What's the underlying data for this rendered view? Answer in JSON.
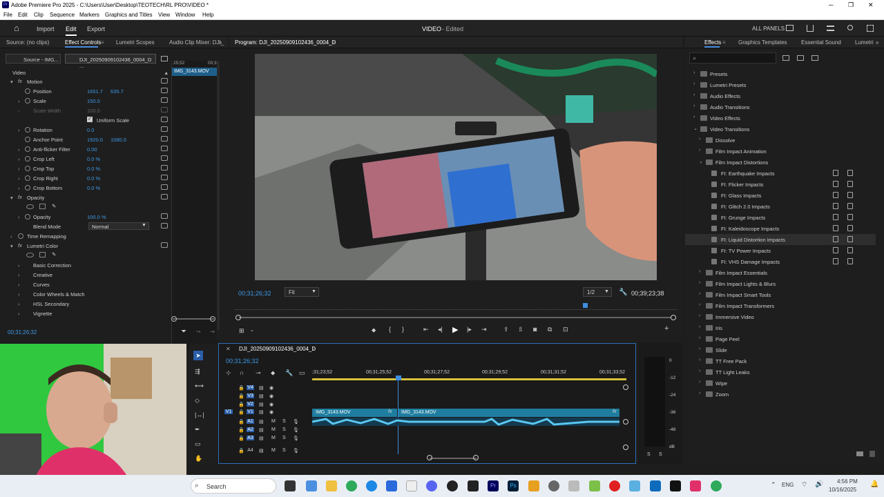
{
  "window": {
    "title": "Adobe Premiere Pro 2025 - C:\\Users\\User\\Desktop\\TEOTECH\\RL PRO\\VIDEO *",
    "minimize": "─",
    "maximize": "❐",
    "close": "✕"
  },
  "menu": [
    "File",
    "Edit",
    "Clip",
    "Sequence",
    "Markers",
    "Graphics and Titles",
    "View",
    "Window",
    "Help"
  ],
  "topbar": {
    "home": "⌂",
    "import": "Import",
    "edit": "Edit",
    "export": "Export",
    "project_title": "VIDEO",
    "project_status": "- Edited",
    "all_panels": "ALL PANELS"
  },
  "left_tabs": {
    "source": "Source: (no clips)",
    "effect_controls": "Effect Controls",
    "lumetri_scopes": "Lumetri Scopes",
    "audio_mixer": "Audio Clip Mixer: DJI_"
  },
  "ec": {
    "source_dd": "Source - IMG...",
    "clip_dd": "DJI_20250909102436_0004_D ...",
    "mini_time": "25;52",
    "mini_time2": "00;3",
    "clip_label": "IMG_3143.MOV",
    "section_video": "Video",
    "motion": "Motion",
    "position": "Position",
    "position_x": "1651.7",
    "position_y": "635.7",
    "scale": "Scale",
    "scale_v": "150.0",
    "scale_width": "Scale Width",
    "scale_width_v": "100.0",
    "uniform_scale": "Uniform Scale",
    "rotation": "Rotation",
    "rotation_v": "0.0",
    "anchor": "Anchor Point",
    "anchor_x": "1920.0",
    "anchor_y": "1080.0",
    "antiflicker": "Anti-flicker Filter",
    "antiflicker_v": "0.00",
    "crop_left": "Crop Left",
    "crop_left_v": "0.0 %",
    "crop_top": "Crop Top",
    "crop_top_v": "0.0 %",
    "crop_right": "Crop Right",
    "crop_right_v": "0.0 %",
    "crop_bottom": "Crop Bottom",
    "crop_bottom_v": "0.0 %",
    "opacity_group": "Opacity",
    "opacity": "Opacity",
    "opacity_v": "100.0 %",
    "blend": "Blend Mode",
    "blend_v": "Normal",
    "time_remap": "Time Remapping",
    "lumetri": "Lumetri Color",
    "basic": "Basic Correction",
    "creative": "Creative",
    "curves": "Curves",
    "wheels": "Color Wheels & Match",
    "hsl": "HSL Secondary",
    "vignette": "Vignette",
    "timecode": "00;31;26;32"
  },
  "program": {
    "tab": "Program: DJI_20250909102436_0004_D",
    "timecode": "00;31;26;32",
    "fit": "Fit",
    "resolution": "1/2",
    "duration": "00;39;23;38"
  },
  "effects": {
    "tab": "Effects",
    "tab_graphics": "Graphics Templates",
    "tab_sound": "Essential Sound",
    "tab_lumetri": "Lumetri",
    "tree": [
      {
        "d": 0,
        "label": "Presets",
        "open": false
      },
      {
        "d": 0,
        "label": "Lumetri Presets",
        "open": false
      },
      {
        "d": 0,
        "label": "Audio Effects",
        "open": false
      },
      {
        "d": 0,
        "label": "Audio Transitions",
        "open": false
      },
      {
        "d": 0,
        "label": "Video Effects",
        "open": false
      },
      {
        "d": 0,
        "label": "Video Transitions",
        "open": true
      },
      {
        "d": 1,
        "label": "Dissolve",
        "open": false
      },
      {
        "d": 1,
        "label": "Film Impact Animation",
        "open": false
      },
      {
        "d": 1,
        "label": "Film Impact Distortions",
        "open": true
      },
      {
        "d": 2,
        "label": "FI: Earthquake Impacts",
        "item": true
      },
      {
        "d": 2,
        "label": "FI: Flicker Impacts",
        "item": true
      },
      {
        "d": 2,
        "label": "FI: Glass Impacts",
        "item": true
      },
      {
        "d": 2,
        "label": "FI: Glitch 2.0 Impacts",
        "item": true
      },
      {
        "d": 2,
        "label": "FI: Grunge Impacts",
        "item": true
      },
      {
        "d": 2,
        "label": "FI: Kaleidoscope Impacts",
        "item": true
      },
      {
        "d": 2,
        "label": "FI: Liquid Distortion Impacts",
        "item": true,
        "sel": true
      },
      {
        "d": 2,
        "label": "FI: TV Power Impacts",
        "item": true
      },
      {
        "d": 2,
        "label": "FI: VHS Damage Impacts",
        "item": true
      },
      {
        "d": 1,
        "label": "Film Impact Essentials",
        "open": false
      },
      {
        "d": 1,
        "label": "Film Impact Lights & Blurs",
        "open": false
      },
      {
        "d": 1,
        "label": "Film Impact Smart Tools",
        "open": false
      },
      {
        "d": 1,
        "label": "Film Impact Transformers",
        "open": false
      },
      {
        "d": 1,
        "label": "Immersive Video",
        "open": false
      },
      {
        "d": 1,
        "label": "Iris",
        "open": false
      },
      {
        "d": 1,
        "label": "Page Peel",
        "open": false
      },
      {
        "d": 1,
        "label": "Slide",
        "open": false
      },
      {
        "d": 1,
        "label": "TT Free Pack",
        "open": false
      },
      {
        "d": 1,
        "label": "TT Light Leaks",
        "open": false
      },
      {
        "d": 1,
        "label": "Wipe",
        "open": false
      },
      {
        "d": 1,
        "label": "Zoom",
        "open": false
      }
    ]
  },
  "timeline": {
    "tab": "DJI_20250909102436_0004_D",
    "timecode": "00;31;26;32",
    "ruler": [
      ";31;23;52",
      "00;31;25;52",
      "00;31;27;52",
      "00;31;29;52",
      "00;31;31;52",
      "00;31;33;52"
    ],
    "tracks_v": [
      "V4",
      "V3",
      "V2",
      "V1"
    ],
    "tracks_a": [
      "A1",
      "A2",
      "A3",
      "A4"
    ],
    "clip1": "IMG_3143.MOV",
    "clip2": "IMG_3143.MOV",
    "meter": [
      "0",
      "-12",
      "-24",
      "-36",
      "-48",
      "dB"
    ],
    "solo": [
      "S",
      "S"
    ]
  },
  "taskbar": {
    "search": "Search",
    "lang": "ENG",
    "time": "4:56 PM",
    "date": "10/16/2025"
  }
}
